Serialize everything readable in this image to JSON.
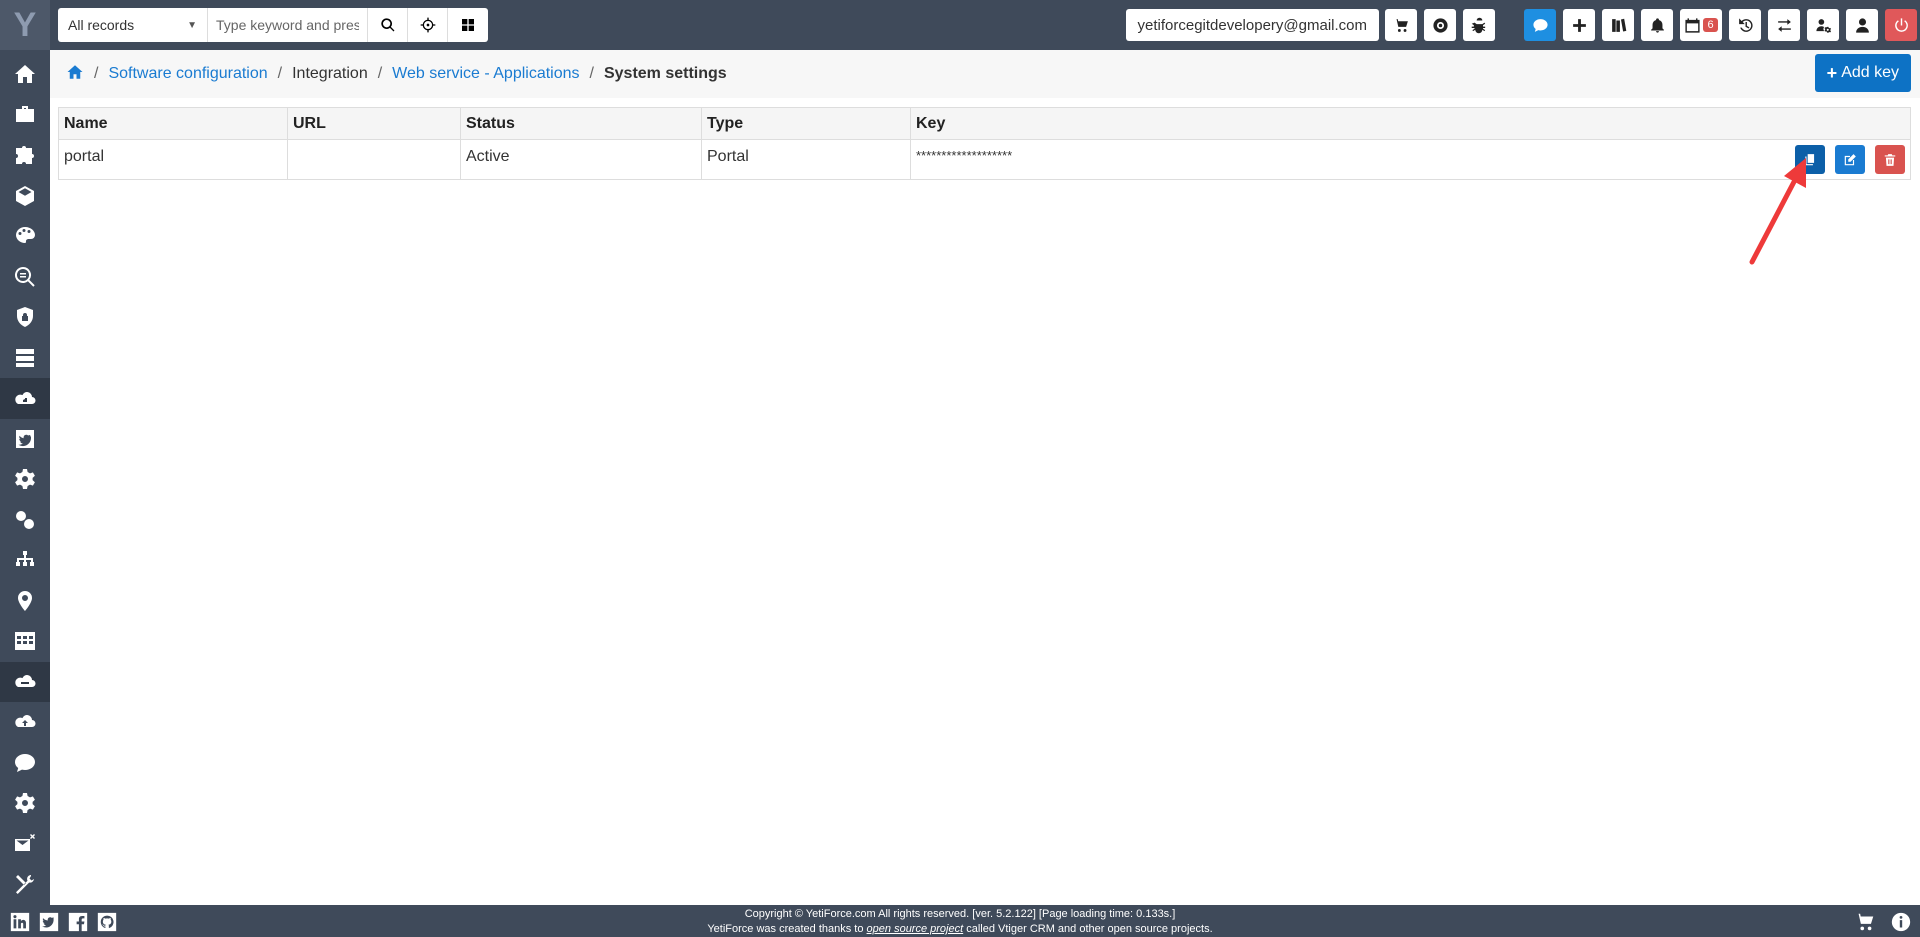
{
  "sidebar": {
    "logo": "Y",
    "items": [
      {
        "icon": "home-icon"
      },
      {
        "icon": "briefcase-icon"
      },
      {
        "icon": "puzzle-icon"
      },
      {
        "icon": "cubes-icon"
      },
      {
        "icon": "palette-icon"
      },
      {
        "icon": "search-list-icon"
      },
      {
        "icon": "shield-icon"
      },
      {
        "icon": "server-icon"
      },
      {
        "icon": "cloud-key-icon"
      },
      {
        "icon": "twitter-icon"
      },
      {
        "icon": "gear-icon"
      },
      {
        "icon": "gears-icon"
      },
      {
        "icon": "sitemap-icon"
      },
      {
        "icon": "map-marker-icon"
      },
      {
        "icon": "calendar-grid-icon"
      },
      {
        "icon": "cloud-storage-icon"
      },
      {
        "icon": "cloud-upload-icon"
      },
      {
        "icon": "sms-icon"
      },
      {
        "icon": "cog-icon"
      },
      {
        "icon": "mail-off-icon"
      },
      {
        "icon": "tools-icon"
      },
      {
        "icon": "document-icon"
      }
    ]
  },
  "search": {
    "scope": "All records",
    "placeholder": "Type keyword and press"
  },
  "header": {
    "user_email": "yetiforcegitdevelopery@gmail.com",
    "calendar_count": "6"
  },
  "breadcrumb": {
    "items": [
      {
        "label": "Software configuration",
        "link": true
      },
      {
        "label": "Integration",
        "link": false
      },
      {
        "label": "Web service - Applications",
        "link": true
      },
      {
        "label": "System settings",
        "current": true
      }
    ]
  },
  "toolbar": {
    "add_key_label": "Add key"
  },
  "table": {
    "headers": [
      "Name",
      "URL",
      "Status",
      "Type",
      "Key"
    ],
    "rows": [
      {
        "name": "portal",
        "url": "",
        "status": "Active",
        "type": "Portal",
        "key": "*******************"
      }
    ]
  },
  "footer": {
    "line1": "Copyright © YetiForce.com All rights reserved. [ver. 5.2.122] [Page loading time: 0.133s.]",
    "line2_pre": "YetiForce was created thanks to ",
    "line2_link": "open source project",
    "line2_post": " called Vtiger CRM and other open source projects."
  },
  "colors": {
    "sidebar_bg": "#3f4a5a",
    "primary": "#1a7bd1",
    "danger": "#d9534f"
  }
}
